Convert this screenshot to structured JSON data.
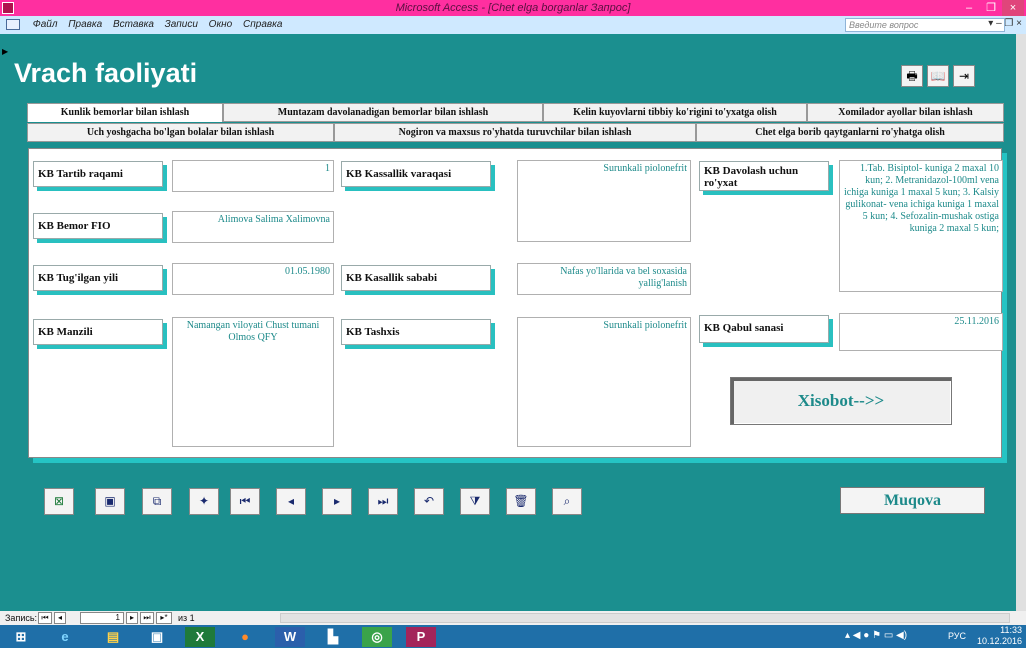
{
  "window": {
    "title": "Microsoft Access - [Chet elga borganlar Запрос]",
    "min": "–",
    "max": "❐",
    "close": "×"
  },
  "menu": {
    "items": [
      "Файл",
      "Правка",
      "Вставка",
      "Записи",
      "Окно",
      "Справка"
    ],
    "ask_placeholder": "Введите вопрос",
    "ctl": "▾ – ❐ ×"
  },
  "form": {
    "title": "Vrach faoliyati",
    "toolbar_icons": [
      "printer-icon",
      "book-icon",
      "exit-door-icon"
    ],
    "tabs_row1": [
      "Kunlik bemorlar bilan ishlash",
      "Muntazam davolanadigan bemorlar bilan ishlash",
      "Kelin kuyovlarni tibbiy ko'rigini to'yxatga olish",
      "Xomilador ayollar bilan ishlash"
    ],
    "tabs_row2": [
      "Uch yoshgacha bo'lgan bolalar bilan ishlash",
      "Nogiron va maxsus ro'yhatda turuvchilar bilan ishlash",
      "Chet elga borib qaytganlarni ro'yhatga olish"
    ],
    "fields": {
      "tartib": {
        "label": "KB Tartib raqami",
        "value": "1"
      },
      "fio": {
        "label": "KB Bemor FIO",
        "value": "Alimova Salima Xalimovna"
      },
      "tugilgan": {
        "label": "KB Tug'ilgan yili",
        "value": "01.05.1980"
      },
      "manzil": {
        "label": "KB Manzili",
        "value": "Namangan viloyati Chust tumani Olmos QFY"
      },
      "varaqa": {
        "label": "KB Kassallik varaqasi",
        "value": "Surunkali piolonefrit"
      },
      "sabab": {
        "label": "KB Kasallik sababi",
        "value": "Nafas yo'llarida va bel soxasida yallig'lanish"
      },
      "tashxis": {
        "label": "KB Tashxis",
        "value": "Surunkali piolonefrit"
      },
      "davolash": {
        "label": "KB Davolash uchun ro'yxat",
        "value": "1.Tab. Bisiptol- kuniga 2 maxal 10 kun; 2. Metranidazol-100ml vena ichiga kuniga 1 maxal 5 kun; 3. Kalsiy gulikonat- vena ichiga kuniga 1 maxal 5 kun; 4. Sefozalin-mushak ostiga kuniga 2 maxal 5 kun;"
      },
      "qabul": {
        "label": "KB Qabul sanasi",
        "value": "25.11.2016"
      }
    },
    "report_button": "Xisobot-->>",
    "cover_button": "Muqova",
    "nav_buttons": [
      {
        "name": "excel-export-button",
        "glyph": "⊠"
      },
      {
        "name": "save-button",
        "glyph": "▣"
      },
      {
        "name": "copy-button",
        "glyph": "⧉"
      },
      {
        "name": "new-record-button",
        "glyph": "✦"
      },
      {
        "name": "first-record-button",
        "glyph": "⏮"
      },
      {
        "name": "prev-record-button",
        "glyph": "◂"
      },
      {
        "name": "next-record-button",
        "glyph": "▸"
      },
      {
        "name": "last-record-button",
        "glyph": "⏭"
      },
      {
        "name": "undo-button",
        "glyph": "↶"
      },
      {
        "name": "filter-button",
        "glyph": "⧩"
      },
      {
        "name": "delete-button",
        "glyph": "🗑"
      },
      {
        "name": "find-button",
        "glyph": "⌕"
      }
    ]
  },
  "status": {
    "records_label": "Запись:",
    "current": "1",
    "of_text": "из 1",
    "nav": [
      "⏮",
      "◂",
      "▸",
      "⏭",
      "▸*"
    ]
  },
  "taskbar": {
    "items": [
      "⊞",
      "e",
      "▤",
      "▣",
      "X",
      "●",
      "W",
      "▙",
      "◎",
      "P"
    ],
    "lang": "РУС",
    "time": "11:33",
    "date": "10.12.2016"
  }
}
